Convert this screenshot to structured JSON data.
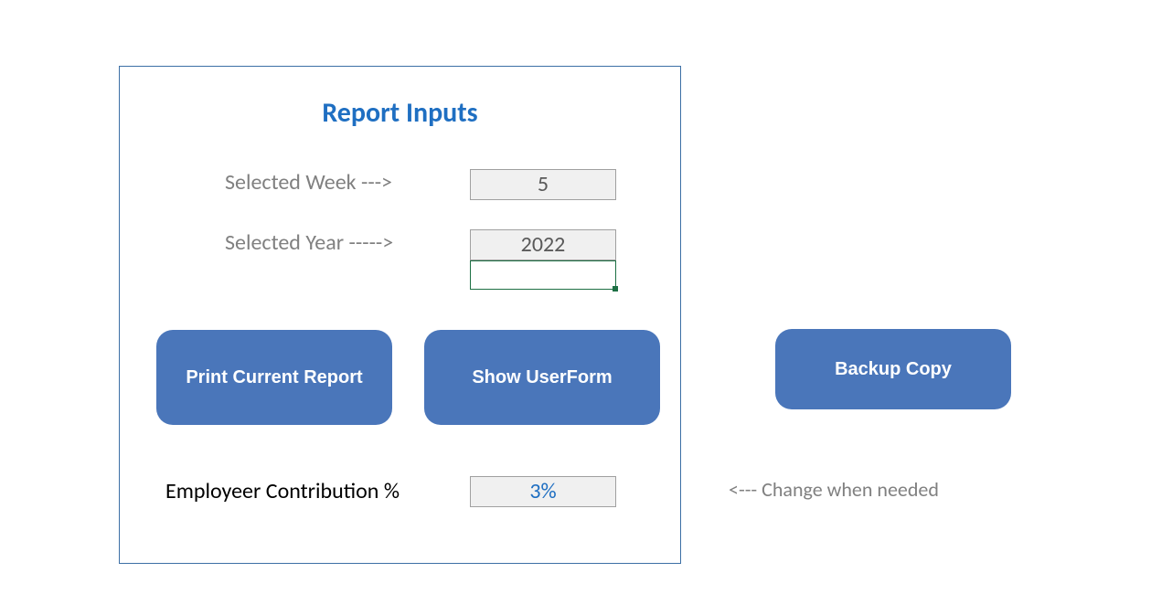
{
  "panel": {
    "title": "Report Inputs",
    "week_label": "Selected Week --->",
    "week_value": "5",
    "year_label": "Selected Year ----->",
    "year_value": "2022",
    "contrib_label": "Employeer Contribution %",
    "contrib_value": "3%"
  },
  "buttons": {
    "print": "Print Current Report",
    "userform": "Show UserForm",
    "backup": "Backup Copy"
  },
  "hint": "<--- Change when needed"
}
